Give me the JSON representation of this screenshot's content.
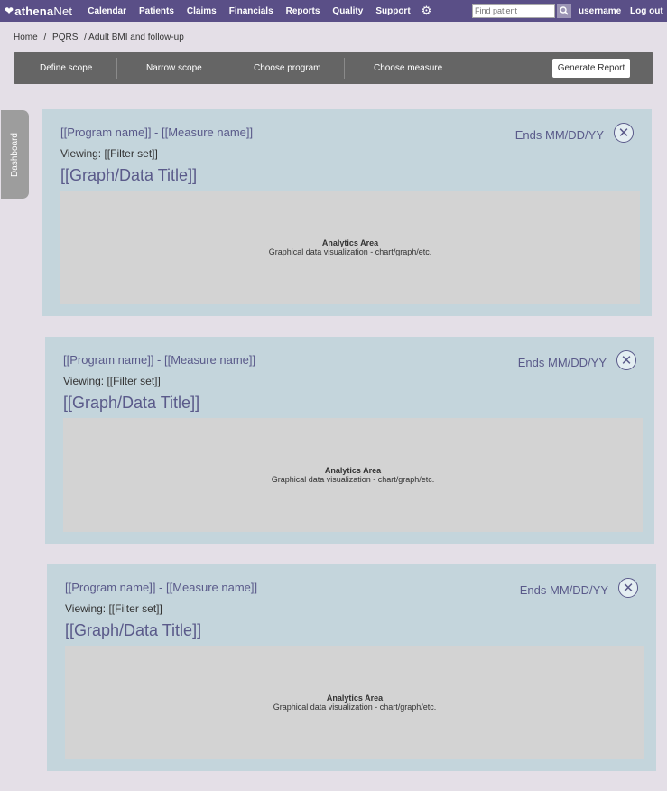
{
  "nav": {
    "logo_mark": "❤",
    "logo_a": "athena",
    "logo_b": "Net",
    "items": [
      "Calendar",
      "Patients",
      "Claims",
      "Financials",
      "Reports",
      "Quality",
      "Support"
    ],
    "search_placeholder": "Find patient",
    "username": "username",
    "logout": "Log out"
  },
  "breadcrumb": [
    "Home",
    "/",
    "PQRS",
    "/ Adult BMI and follow-up"
  ],
  "steps": [
    "Define scope",
    "Narrow scope",
    "Choose program",
    "Choose measure"
  ],
  "generate_button": "Generate Report",
  "dashboard_tab": "Dashboard",
  "panels": [
    {
      "title": "[[Program name]] - [[Measure name]]",
      "viewing": "Viewing: [[Filter set]]",
      "graph_title": "[[Graph/Data Title]]",
      "ends": "Ends MM/DD/YY",
      "analytics_title": "Analytics Area",
      "analytics_sub": "Graphical data visualization - chart/graph/etc."
    },
    {
      "title": "[[Program name]] - [[Measure name]]",
      "viewing": "Viewing: [[Filter set]]",
      "graph_title": "[[Graph/Data Title]]",
      "ends": "Ends MM/DD/YY",
      "analytics_title": "Analytics Area",
      "analytics_sub": "Graphical data visualization - chart/graph/etc."
    },
    {
      "title": "[[Program name]] - [[Measure name]]",
      "viewing": "Viewing: [[Filter set]]",
      "graph_title": "[[Graph/Data Title]]",
      "ends": "Ends MM/DD/YY",
      "analytics_title": "Analytics Area",
      "analytics_sub": "Graphical data visualization - chart/graph/etc."
    }
  ],
  "icons": {
    "settings": "gear-icon",
    "search": "search-icon",
    "close": "close-icon"
  },
  "colors": {
    "nav_bg": "#5a4f87",
    "stepbar_bg": "#656565",
    "panel_bg": "#c4d5dc",
    "accent_text": "#5a5a8a"
  }
}
